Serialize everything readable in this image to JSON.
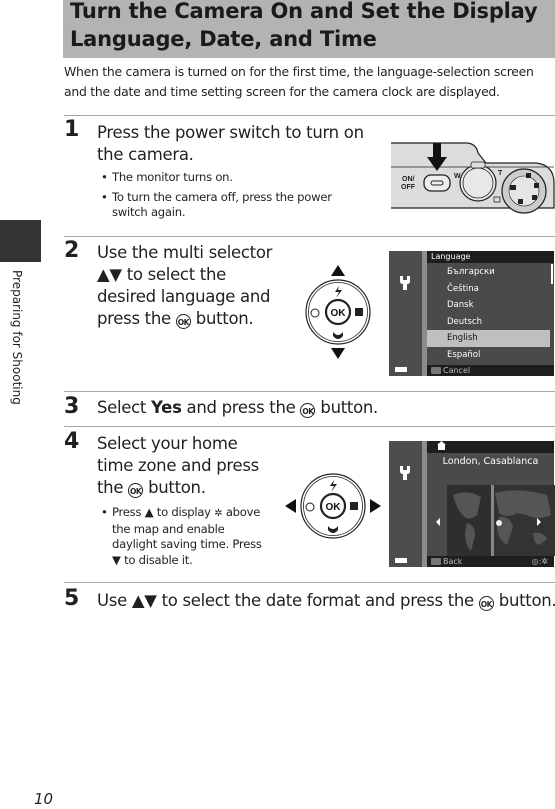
{
  "title": "Turn the Camera On and Set the Display Language, Date, and Time",
  "intro": "When the camera is turned on for the first time, the language-selection screen and the date and time setting screen for the camera clock are displayed.",
  "side_tab": {
    "label": "Preparing for Shooting"
  },
  "page_number": "10",
  "steps": [
    {
      "number": "1",
      "title_lines": [
        "Press the power switch to turn on",
        "the camera."
      ],
      "bullets": [
        "The monitor turns on.",
        "To turn the camera off, press the power switch again."
      ],
      "illustration": {
        "power_label_1": "ON/",
        "power_label_2": "OFF",
        "zoom_w": "W",
        "zoom_t": "T"
      }
    },
    {
      "number": "2",
      "title_lines": [
        "Use the multi selector",
        "▲▼ to select the",
        "desired language and",
        "press the",
        "button."
      ],
      "screen": {
        "header": "Language",
        "items": [
          "Български",
          "Čeština",
          "Dansk",
          "Deutsch",
          "English",
          "Español"
        ],
        "selected": "English",
        "footer": "Cancel"
      }
    },
    {
      "number": "3",
      "text_pre": "Select ",
      "text_bold": "Yes",
      "text_post": " and press the",
      "text_end": " button."
    },
    {
      "number": "4",
      "title_lines": [
        "Select your home",
        "time zone and press",
        "the",
        "button."
      ],
      "bullets": [
        "Press ▲ to display",
        "above the map and enable daylight saving time. Press",
        "▼ to disable it."
      ],
      "screen": {
        "city": "London, Casablanca",
        "footer": "Back",
        "footer_right": ":"
      }
    },
    {
      "number": "5",
      "text_pre": "Use ▲▼ to select the date format and press the",
      "text_end": " button."
    }
  ],
  "ok_label": "OK",
  "multi_selector": {
    "center": "OK"
  }
}
